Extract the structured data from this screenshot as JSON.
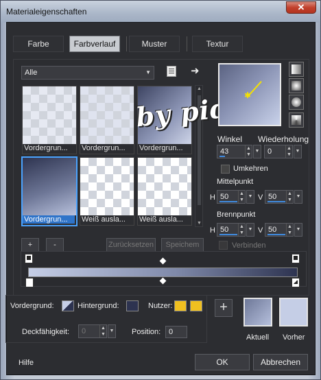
{
  "window": {
    "title": "Materialeigenschaften",
    "close_glyph": "✕"
  },
  "tabs": [
    {
      "label": "Farbe"
    },
    {
      "label": "Farbverlauf",
      "active": true
    },
    {
      "label": "Muster"
    },
    {
      "label": "Textur"
    }
  ],
  "gallery": {
    "filter_value": "Alle",
    "items": [
      {
        "label": "Vordergrun..."
      },
      {
        "label": "Vordergrun..."
      },
      {
        "label": "Vordergrun..."
      },
      {
        "label": "Vordergrun...",
        "selected": true
      },
      {
        "label": "Weiß ausla..."
      },
      {
        "label": "Weiß ausla..."
      }
    ]
  },
  "watermark_text": "by pida",
  "buttons": {
    "add": "+",
    "remove": "-",
    "reset": "Zurücksetzen",
    "save": "Speichem"
  },
  "params": {
    "angle_label": "Winkel",
    "angle_value": "43",
    "repeat_label": "Wiederholung",
    "repeat_value": "0",
    "invert_label": "Umkehren",
    "center_label": "Mittelpunkt",
    "center_h_label": "H",
    "center_h": "50",
    "center_v_label": "V",
    "center_v": "50",
    "focus_label": "Brennpunkt",
    "focus_h_label": "H",
    "focus_h": "50",
    "focus_v_label": "V",
    "focus_v": "50",
    "link_label": "Verbinden"
  },
  "bottom": {
    "foreground_label": "Vordergrund:",
    "background_label": "Hintergrund:",
    "user_label": "Nutzer:",
    "opacity_label": "Deckfähigkeit:",
    "opacity_value": "0",
    "position_label": "Position:",
    "position_value": "0",
    "add_glyph": "+",
    "current_label": "Aktuell",
    "previous_label": "Vorher"
  },
  "footer": {
    "help": "Hilfe",
    "ok": "OK",
    "cancel": "Abbrechen"
  },
  "colors": {
    "accent": "#2f74c9",
    "user_swatch": "#f0c020",
    "gradient_dark": "#2d3350",
    "gradient_light": "#c5cee6"
  }
}
